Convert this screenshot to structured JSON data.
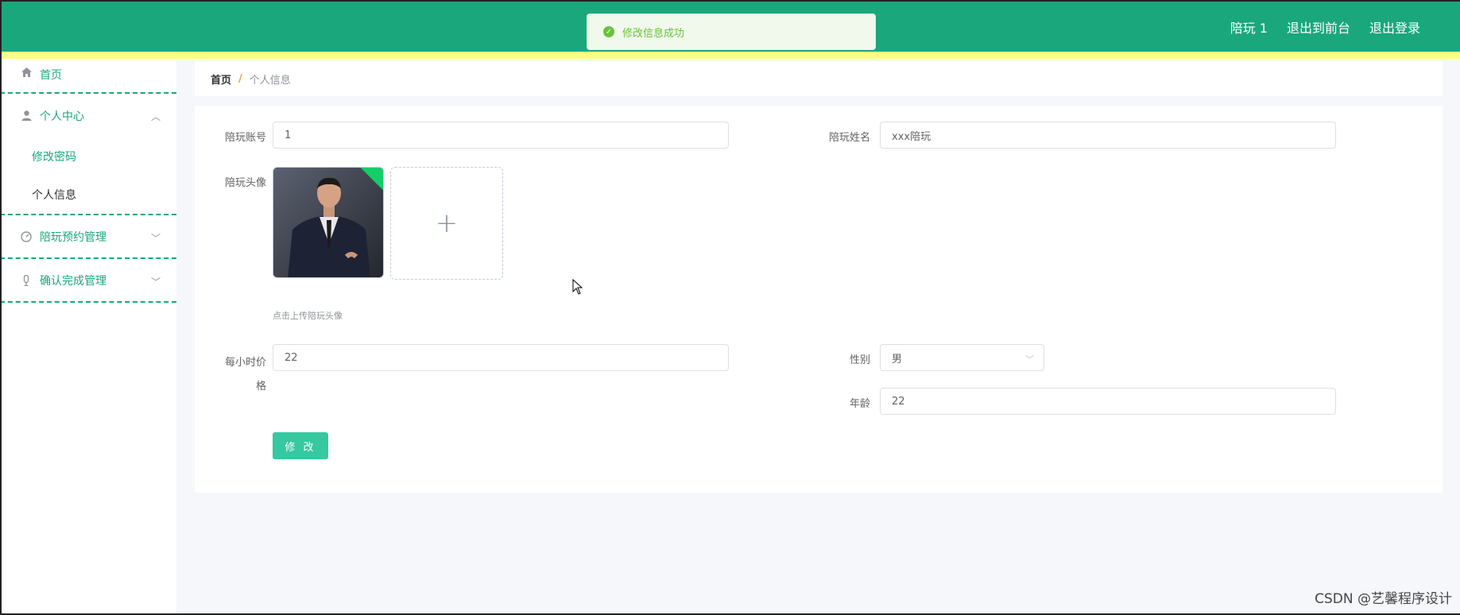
{
  "header": {
    "user_label": "陪玩 1",
    "exit_front_label": "退出到前台",
    "logout_label": "退出登录"
  },
  "toast": {
    "message": "修改信息成功"
  },
  "sidebar": {
    "home": "首页",
    "personal_center": "个人中心",
    "change_password": "修改密码",
    "personal_info": "个人信息",
    "booking_mgmt": "陪玩预约管理",
    "confirm_mgmt": "确认完成管理"
  },
  "breadcrumb": {
    "home": "首页",
    "separator": "/",
    "current": "个人信息"
  },
  "form": {
    "account_label": "陪玩账号",
    "account_value": "1",
    "name_label": "陪玩姓名",
    "name_value": "xxx陪玩",
    "avatar_label": "陪玩头像",
    "upload_plus": "+",
    "upload_tip": "点击上传陪玩头像",
    "price_label_line1": "每小时价",
    "price_label_line2": "格",
    "price_value": "22",
    "gender_label": "性别",
    "gender_value": "男",
    "age_label": "年龄",
    "age_value": "22",
    "submit_label": "修 改"
  },
  "watermark": "CSDN @艺馨程序设计",
  "colors": {
    "header_bg": "#1aa77b",
    "header_stripe": "#fbff80",
    "accent": "#1aa77b",
    "button": "#36c8a0",
    "toast_bg": "#f0f9eb",
    "toast_text": "#67c23a"
  },
  "icons": {
    "home": "home-icon",
    "user": "user-icon",
    "gauge": "gauge-icon",
    "mic": "microphone-icon",
    "success": "check-circle-icon",
    "chevron": "chevron-icon"
  }
}
